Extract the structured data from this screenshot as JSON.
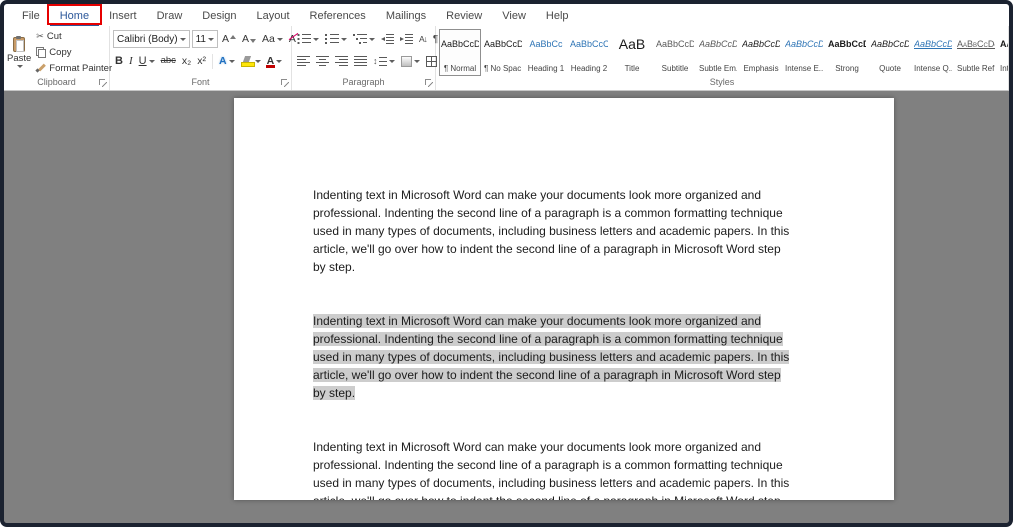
{
  "colors": {
    "accent_blue": "#2b579a",
    "highlight_red": "#e60000",
    "selection_gray": "#cdcdcd",
    "canvas_gray": "#808080"
  },
  "tabs": [
    "File",
    "Home",
    "Insert",
    "Draw",
    "Design",
    "Layout",
    "References",
    "Mailings",
    "Review",
    "View",
    "Help"
  ],
  "ribbon": {
    "clipboard": {
      "label": "Clipboard",
      "paste": "Paste",
      "cut": "Cut",
      "copy": "Copy",
      "format_painter": "Format Painter"
    },
    "font": {
      "label": "Font",
      "name": "Calibri (Body)",
      "size": "11",
      "bold": "B",
      "italic": "I",
      "underline": "U",
      "strike": "abc",
      "subscript": "x₂",
      "superscript": "x²",
      "grow": "A",
      "shrink": "A",
      "change_case": "Aa",
      "clear": "A",
      "effects": "A",
      "font_color": "A"
    },
    "paragraph": {
      "label": "Paragraph",
      "sort": "A↓",
      "pilcrow": "¶",
      "spacing_arrow": "↕"
    },
    "styles": {
      "label": "Styles",
      "items": [
        {
          "preview": "AaBbCcDc",
          "name": "¶ Normal"
        },
        {
          "preview": "AaBbCcDc",
          "name": "¶ No Spac..."
        },
        {
          "preview": "AaBbCc",
          "name": "Heading 1"
        },
        {
          "preview": "AaBbCcC",
          "name": "Heading 2"
        },
        {
          "preview": "AaB",
          "name": "Title"
        },
        {
          "preview": "AaBbCcD",
          "name": "Subtitle"
        },
        {
          "preview": "AaBbCcD",
          "name": "Subtle Em..."
        },
        {
          "preview": "AaBbCcDc",
          "name": "Emphasis"
        },
        {
          "preview": "AaBbCcDc",
          "name": "Intense E..."
        },
        {
          "preview": "AaBbCcDc",
          "name": "Strong"
        },
        {
          "preview": "AaBbCcDc",
          "name": "Quote"
        },
        {
          "preview": "AaBbCcDc",
          "name": "Intense Q..."
        },
        {
          "preview": "AaBbCcDc",
          "name": "Subtle Ref..."
        },
        {
          "preview": "AaBbCcDc",
          "name": "Intense R..."
        }
      ]
    }
  },
  "document": {
    "paragraphs": [
      {
        "text": "Indenting text in Microsoft Word can make your documents look more organized and professional. Indenting the second line of a paragraph is a common formatting technique used in many types of documents, including business letters and academic papers. In this article, we'll go over how to indent the second line of a paragraph in Microsoft Word step by step.",
        "selected": false
      },
      {
        "text": "Indenting text in Microsoft Word can make your documents look more organized and professional. Indenting the second line of a paragraph is a common formatting technique used in many types of documents, including business letters and academic papers. In this article, we'll go over how to indent the second line of a paragraph in Microsoft Word step by step.",
        "selected": true
      },
      {
        "text": "Indenting text in Microsoft Word can make your documents look more organized and professional. Indenting the second line of a paragraph is a common formatting technique used in many types of documents, including business letters and academic papers. In this article, we'll go over how to indent the second line of a paragraph in Microsoft Word step by step.",
        "selected": false
      }
    ]
  }
}
